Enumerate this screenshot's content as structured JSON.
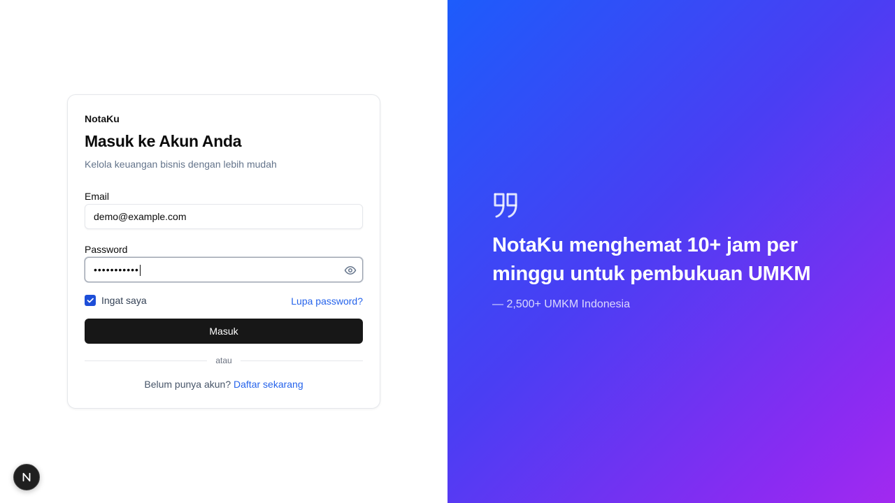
{
  "login_card": {
    "brand": "NotaKu",
    "title": "Masuk ke Akun Anda",
    "subtitle": "Kelola keuangan bisnis dengan lebih mudah",
    "email_label": "Email",
    "email_value": "demo@example.com",
    "password_label": "Password",
    "password_value": "•••••••••••",
    "remember_label": "Ingat saya",
    "remember_checked": true,
    "forgot_link": "Lupa password?",
    "submit_label": "Masuk",
    "divider_text": "atau",
    "signup_prompt": "Belum punya akun?",
    "signup_link": "Daftar sekarang"
  },
  "testimonial": {
    "quote": "NotaKu menghemat 10+ jam per minggu untuk pembukuan UMKM",
    "attribution": "— 2,500+ UMKM Indonesia"
  },
  "icons": {
    "eye": "eye-icon",
    "quote": "quote-icon",
    "check": "check-icon",
    "next": "nextjs-logo-icon"
  },
  "colors": {
    "primary_button": "#171717",
    "link": "#2563eb",
    "gradient_start": "#1d5cfb",
    "gradient_end": "#a229f0"
  }
}
